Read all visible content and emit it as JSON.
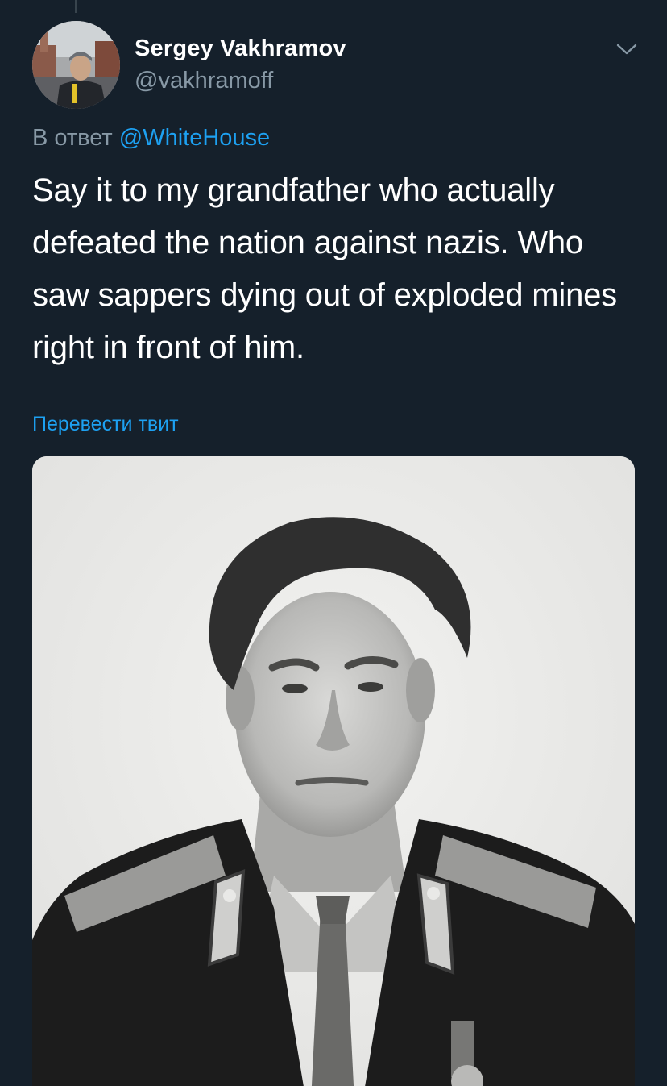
{
  "tweet": {
    "author": {
      "display_name": "Sergey Vakhramov",
      "handle": "@vakhramoff",
      "avatar_icon": "user-avatar-photo"
    },
    "reply_prefix": "В ответ",
    "reply_to": "@WhiteHouse",
    "text": "Say it to my grandfather who actually defeated the nation against nazis. Who saw sappers dying out of exploded mines right in front of him.",
    "translate_label": "Перевести твит",
    "menu_icon": "chevron-down-icon",
    "media": {
      "type": "photo",
      "description_icon": "portrait-photo"
    }
  },
  "colors": {
    "background": "#15202b",
    "text_primary": "#ffffff",
    "text_secondary": "#8899a6",
    "accent": "#1da1f2"
  }
}
